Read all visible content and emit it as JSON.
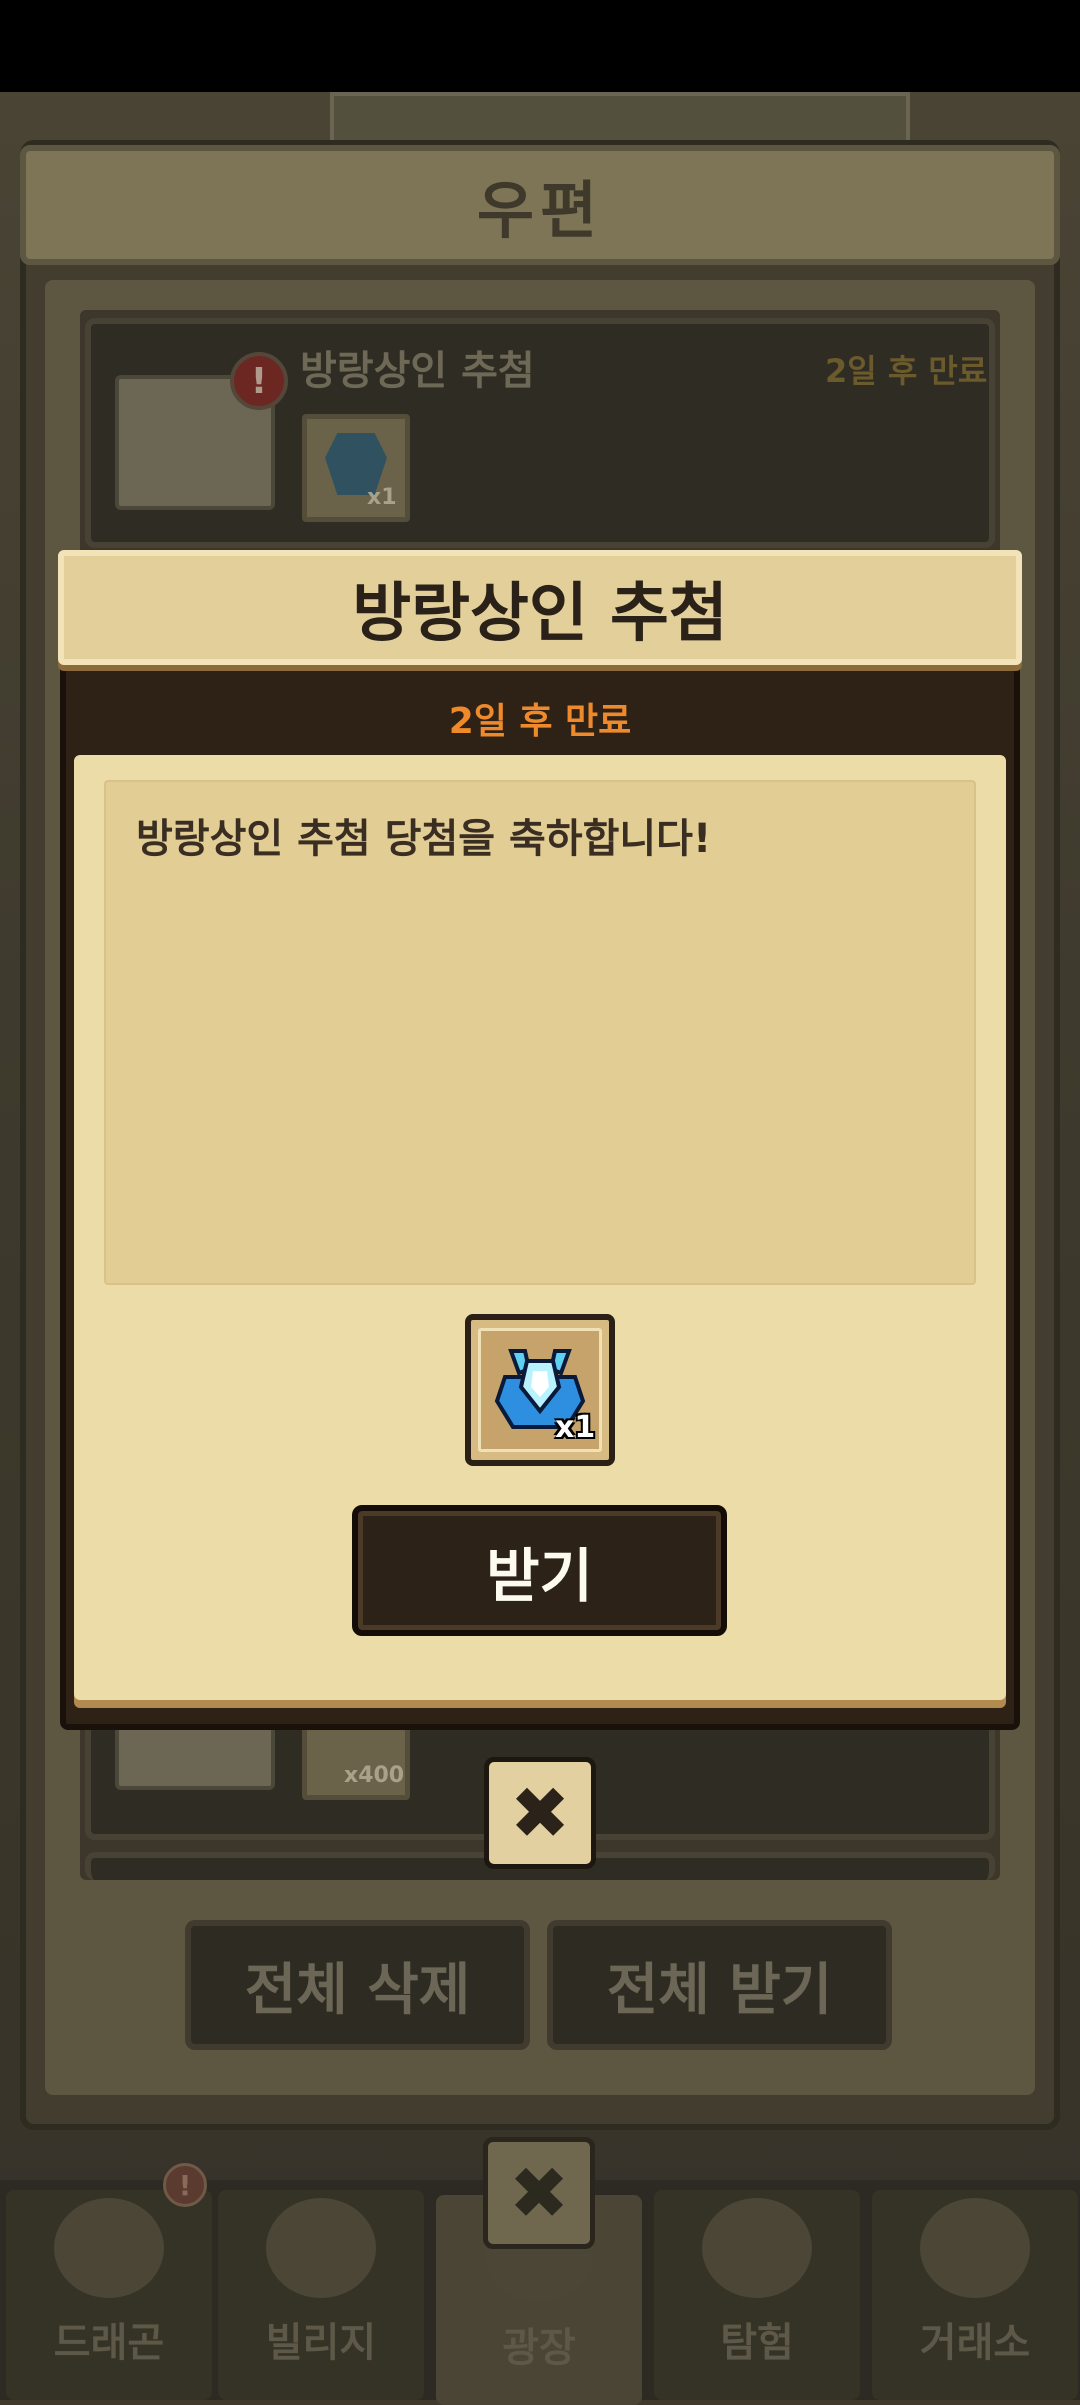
{
  "mail_window": {
    "title": "우편",
    "items": [
      {
        "title": "방랑상인 추첨",
        "expire": "2일 후 만료",
        "reward_qty": "x1"
      },
      {
        "reward_qty": "x400"
      }
    ],
    "delete_all_label": "전체 삭제",
    "claim_all_label": "전체 받기"
  },
  "popup": {
    "title": "방랑상인 추첨",
    "expire": "2일 후 만료",
    "message": "방랑상인 추첨 당첨을 축하합니다!",
    "reward": {
      "icon": "blue-crystal-icon",
      "qty": "x1"
    },
    "claim_label": "받기",
    "close_icon": "✖"
  },
  "bottom_nav": {
    "tabs": [
      {
        "label": "드래곤",
        "badge": "!"
      },
      {
        "label": "빌리지"
      },
      {
        "label": "광장"
      },
      {
        "label": "탐험"
      },
      {
        "label": "거래소"
      }
    ],
    "close_icon": "✖"
  },
  "colors": {
    "popup_expire": "#ee8a2c",
    "paper": "#ecdca8",
    "frame": "#2e2115",
    "claim_button": "#2c2218"
  }
}
